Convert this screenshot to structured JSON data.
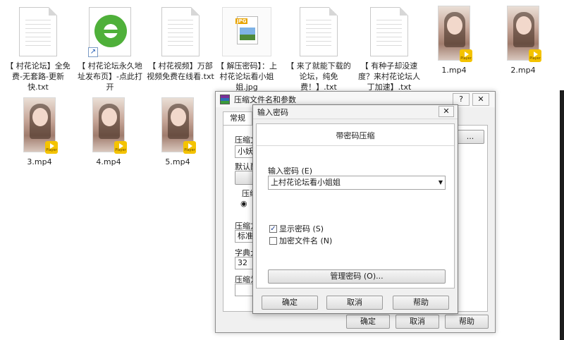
{
  "desktop": {
    "files": [
      {
        "id": "txt1",
        "kind": "txt",
        "name": "【 村花论坛】全免费-无套路-更新快.txt"
      },
      {
        "id": "url1",
        "kind": "ie",
        "name": "【 村花论坛永久地址发布页】-点此打开"
      },
      {
        "id": "txt2",
        "kind": "txt",
        "name": "【 村花视频】万部视频免费在线看.txt"
      },
      {
        "id": "jpg1",
        "kind": "jpg",
        "name": "【 解压密码】：上村花论坛看小姐姐.jpg",
        "badge": "JPG"
      },
      {
        "id": "txt3",
        "kind": "txt",
        "name": "【 来了就能下载的论坛，纯免费！】.txt"
      },
      {
        "id": "txt4",
        "kind": "txt",
        "name": "【 有种子却没速度？来村花论坛人丁加速】.txt"
      },
      {
        "id": "v1",
        "kind": "video",
        "name": "1.mp4",
        "badge": "Player"
      },
      {
        "id": "v2",
        "kind": "video",
        "name": "2.mp4",
        "badge": "Player"
      },
      {
        "id": "v3",
        "kind": "video",
        "name": "3.mp4",
        "badge": "Player"
      },
      {
        "id": "v4",
        "kind": "video",
        "name": "4.mp4",
        "badge": "Player"
      },
      {
        "id": "v5",
        "kind": "video",
        "name": "5.mp4",
        "badge": "Player"
      }
    ]
  },
  "archive_dialog": {
    "title": "压缩文件名和参数",
    "help_btn": "?",
    "close_btn": "✕",
    "tab_general": "常规",
    "label_archive_name": "压缩文",
    "archive_name_value": "小妖",
    "browse_btn": "...",
    "label_default_profile": "默认配",
    "label_format": "压缩",
    "label_method": "压缩方",
    "method_value": "标准",
    "label_dict": "字典大",
    "dict_value": "32 M",
    "label_split": "压缩为",
    "ok_btn": "确定",
    "cancel_btn": "取消",
    "help_label": "帮助"
  },
  "password_dialog": {
    "title": "输入密码",
    "close_btn": "✕",
    "heading": "带密码压缩",
    "password_label": "输入密码 (E)",
    "password_value": "上村花论坛看小姐姐",
    "show_password_label": "显示密码 (S)",
    "show_password_checked": true,
    "encrypt_names_label": "加密文件名 (N)",
    "encrypt_names_checked": false,
    "manage_btn": "管理密码 (O)...",
    "ok_btn": "确定",
    "cancel_btn": "取消",
    "help_btn": "帮助",
    "check_mark": "✓"
  }
}
